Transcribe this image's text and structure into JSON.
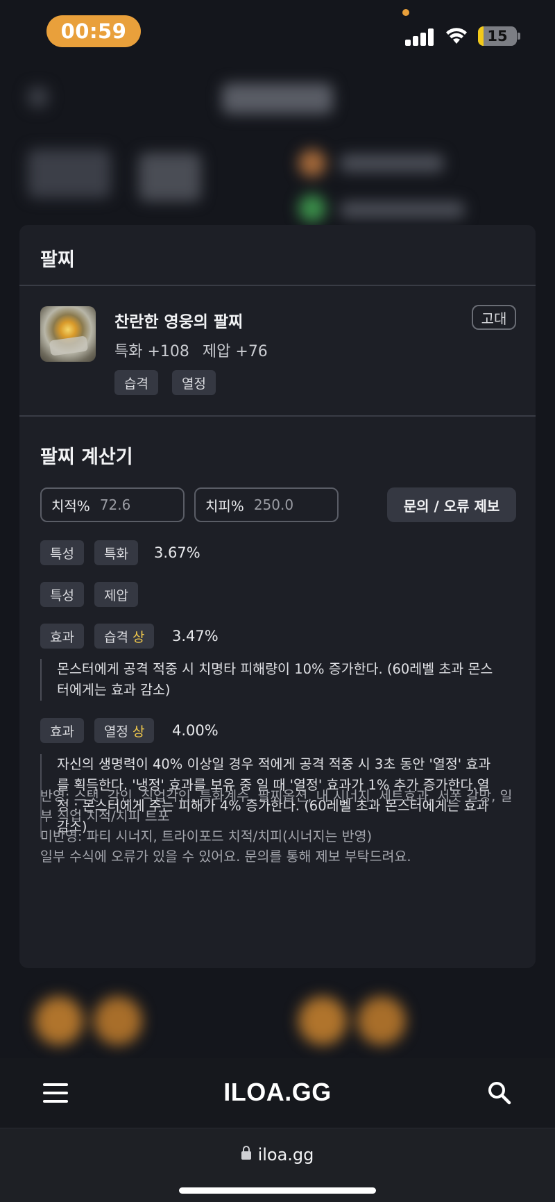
{
  "status_bar": {
    "time": "00:59",
    "battery": "15"
  },
  "bracelet": {
    "section_title": "팔찌",
    "item_name": "찬란한 영웅의 팔찌",
    "grade": "고대",
    "stats": [
      "특화 +108",
      "제압 +76"
    ],
    "tags": [
      "습격",
      "열정"
    ]
  },
  "calculator": {
    "title": "팔찌 계산기",
    "crit_label": "치적%",
    "crit_value": "72.6",
    "critdmg_label": "치피%",
    "critdmg_value": "250.0",
    "report_button": "문의 / 오류 제보",
    "rows": [
      {
        "type": "특성",
        "name": "특화",
        "grade": "",
        "value": "3.67%"
      },
      {
        "type": "특성",
        "name": "제압",
        "grade": "",
        "value": ""
      },
      {
        "type": "효과",
        "name": "습격",
        "grade": "상",
        "value": "3.47%",
        "desc": "몬스터에게 공격 적중 시 치명타 피해량이 10% 증가한다. (60레벨 초과 몬스터에게는 효과 감소)"
      },
      {
        "type": "효과",
        "name": "열정",
        "grade": "상",
        "value": "4.00%",
        "desc": "자신의 생명력이 40% 이상일 경우 적에게 공격 적중 시 3초 동안 '열정' 효과를 획득한다. '냉정' 효과를 보유 중 일 때 '열정' 효과가 1% 추가 증가한다.열정 : 몬스터에게 주는 피해가 4% 증가한다. (60레벨 초과 몬스터에게는 효과 감소)"
      }
    ],
    "notes": [
      "반영: 스탯, 각인, 직업각인, 특화계수, 팔찌옵션, 내 시너지, 세트효과, 서폿 갈망, 일부 직업 치적/치피 트포",
      "미반영: 파티 시너지, 트라이포드 치적/치피(시너지는 반영)",
      "일부 수식에 오류가 있을 수 있어요. 문의를 통해 제보 부탁드려요."
    ]
  },
  "bottom_nav": {
    "logo": "ILOA.GG"
  },
  "browser": {
    "url": "iloa.gg"
  }
}
